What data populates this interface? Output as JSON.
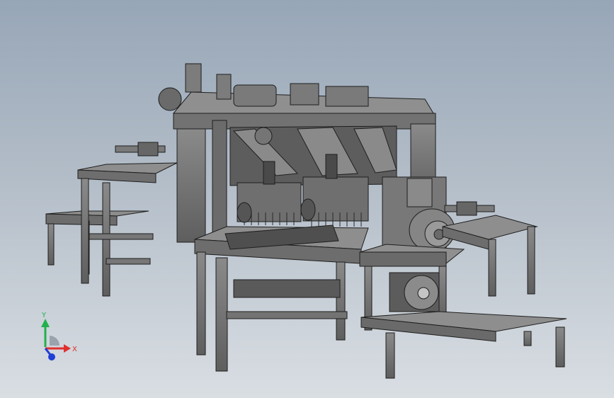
{
  "viewport": {
    "background_top": "#97a6b7",
    "background_bottom": "#d9dee3",
    "model_color": "#7e7e7e"
  },
  "triad": {
    "y_label": "Y",
    "x_label": "X",
    "y_color": "#22b14c",
    "x_color": "#e0302e",
    "z_color": "#1f3fd6"
  }
}
